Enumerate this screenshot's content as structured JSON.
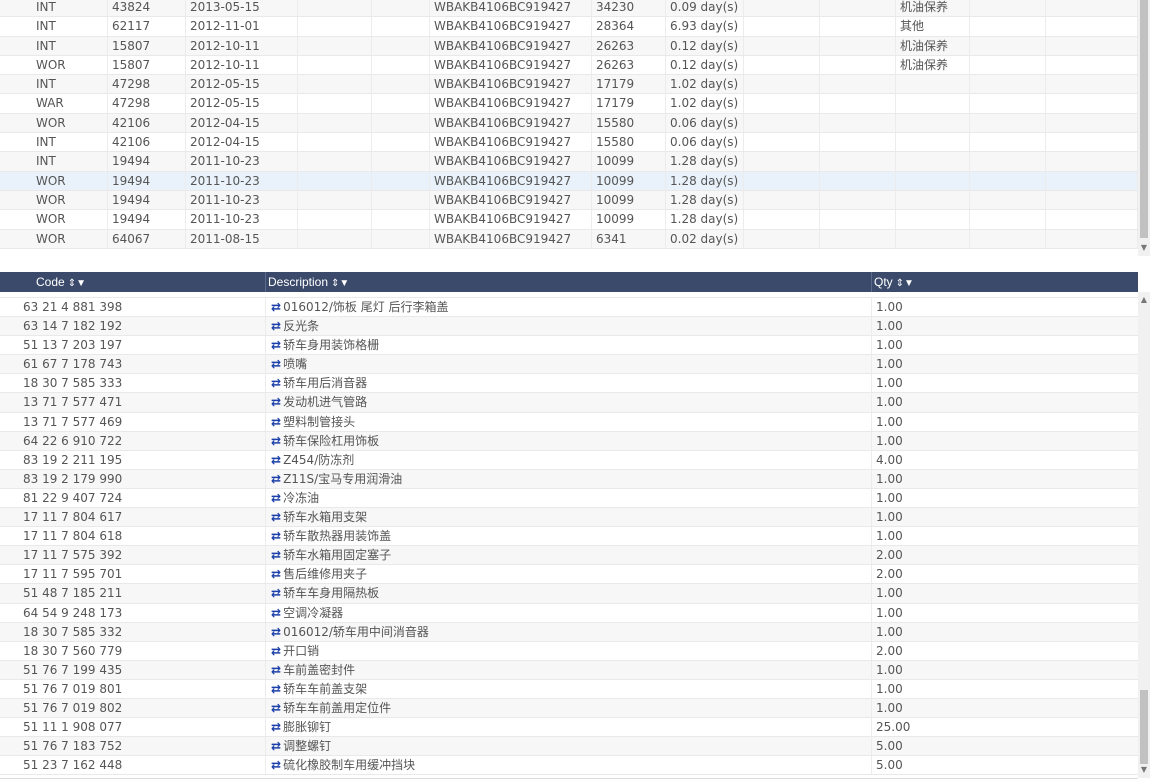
{
  "top_rows": [
    {
      "type": "INT",
      "id": "43824",
      "date": "2013-05-15",
      "vin": "WBAKB4106BC919427",
      "km": "34230",
      "dur": "0.09 day(s)",
      "note": "机油保养"
    },
    {
      "type": "INT",
      "id": "62117",
      "date": "2012-11-01",
      "vin": "WBAKB4106BC919427",
      "km": "28364",
      "dur": "6.93 day(s)",
      "note": "其他"
    },
    {
      "type": "INT",
      "id": "15807",
      "date": "2012-10-11",
      "vin": "WBAKB4106BC919427",
      "km": "26263",
      "dur": "0.12 day(s)",
      "note": "机油保养"
    },
    {
      "type": "WOR",
      "id": "15807",
      "date": "2012-10-11",
      "vin": "WBAKB4106BC919427",
      "km": "26263",
      "dur": "0.12 day(s)",
      "note": "机油保养"
    },
    {
      "type": "INT",
      "id": "47298",
      "date": "2012-05-15",
      "vin": "WBAKB4106BC919427",
      "km": "17179",
      "dur": "1.02 day(s)",
      "note": ""
    },
    {
      "type": "WAR",
      "id": "47298",
      "date": "2012-05-15",
      "vin": "WBAKB4106BC919427",
      "km": "17179",
      "dur": "1.02 day(s)",
      "note": ""
    },
    {
      "type": "WOR",
      "id": "42106",
      "date": "2012-04-15",
      "vin": "WBAKB4106BC919427",
      "km": "15580",
      "dur": "0.06 day(s)",
      "note": ""
    },
    {
      "type": "INT",
      "id": "42106",
      "date": "2012-04-15",
      "vin": "WBAKB4106BC919427",
      "km": "15580",
      "dur": "0.06 day(s)",
      "note": ""
    },
    {
      "type": "INT",
      "id": "19494",
      "date": "2011-10-23",
      "vin": "WBAKB4106BC919427",
      "km": "10099",
      "dur": "1.28 day(s)",
      "note": ""
    },
    {
      "type": "WOR",
      "id": "19494",
      "date": "2011-10-23",
      "vin": "WBAKB4106BC919427",
      "km": "10099",
      "dur": "1.28 day(s)",
      "note": ""
    },
    {
      "type": "WOR",
      "id": "19494",
      "date": "2011-10-23",
      "vin": "WBAKB4106BC919427",
      "km": "10099",
      "dur": "1.28 day(s)",
      "note": ""
    },
    {
      "type": "WOR",
      "id": "19494",
      "date": "2011-10-23",
      "vin": "WBAKB4106BC919427",
      "km": "10099",
      "dur": "1.28 day(s)",
      "note": ""
    },
    {
      "type": "WOR",
      "id": "64067",
      "date": "2011-08-15",
      "vin": "WBAKB4106BC919427",
      "km": "6341",
      "dur": "0.02 day(s)",
      "note": ""
    }
  ],
  "parts_header": {
    "code": "Code",
    "description": "Description",
    "qty": "Qty",
    "sort_filter": "⇕▼"
  },
  "parts": [
    {
      "code": "63 21 4 881 398",
      "desc": "016012/饰板 尾灯 后行李箱盖",
      "qty": "1.00"
    },
    {
      "code": "63 14 7 182 192",
      "desc": "反光条",
      "qty": "1.00"
    },
    {
      "code": "51 13 7 203 197",
      "desc": "轿车身用装饰格栅",
      "qty": "1.00"
    },
    {
      "code": "61 67 7 178 743",
      "desc": "喷嘴",
      "qty": "1.00"
    },
    {
      "code": "18 30 7 585 333",
      "desc": "轿车用后消音器",
      "qty": "1.00"
    },
    {
      "code": "13 71 7 577 471",
      "desc": "发动机进气管路",
      "qty": "1.00"
    },
    {
      "code": "13 71 7 577 469",
      "desc": "塑料制管接头",
      "qty": "1.00"
    },
    {
      "code": "64 22 6 910 722",
      "desc": "轿车保险杠用饰板",
      "qty": "1.00"
    },
    {
      "code": "83 19 2 211 195",
      "desc": "Z454/防冻剂",
      "qty": "4.00"
    },
    {
      "code": "83 19 2 179 990",
      "desc": "Z11S/宝马专用润滑油",
      "qty": "1.00"
    },
    {
      "code": "81 22 9 407 724",
      "desc": "冷冻油",
      "qty": "1.00"
    },
    {
      "code": "17 11 7 804 617",
      "desc": "轿车水箱用支架",
      "qty": "1.00"
    },
    {
      "code": "17 11 7 804 618",
      "desc": "轿车散热器用装饰盖",
      "qty": "1.00"
    },
    {
      "code": "17 11 7 575 392",
      "desc": "轿车水箱用固定塞子",
      "qty": "2.00"
    },
    {
      "code": "17 11 7 595 701",
      "desc": "售后维修用夹子",
      "qty": "2.00"
    },
    {
      "code": "51 48 7 185 211",
      "desc": "轿车车身用隔热板",
      "qty": "1.00"
    },
    {
      "code": "64 54 9 248 173",
      "desc": "空调冷凝器",
      "qty": "1.00"
    },
    {
      "code": "18 30 7 585 332",
      "desc": "016012/轿车用中间消音器",
      "qty": "1.00"
    },
    {
      "code": "18 30 7 560 779",
      "desc": "开口销",
      "qty": "2.00"
    },
    {
      "code": "51 76 7 199 435",
      "desc": "车前盖密封件",
      "qty": "1.00"
    },
    {
      "code": "51 76 7 019 801",
      "desc": "轿车车前盖支架",
      "qty": "1.00"
    },
    {
      "code": "51 76 7 019 802",
      "desc": "轿车车前盖用定位件",
      "qty": "1.00"
    },
    {
      "code": "51 11 1 908 077",
      "desc": "膨胀铆钉",
      "qty": "25.00"
    },
    {
      "code": "51 76 7 183 752",
      "desc": "调整螺钉",
      "qty": "5.00"
    },
    {
      "code": "51 23 7 162 448",
      "desc": "硫化橡胶制车用缓冲挡块",
      "qty": "5.00"
    }
  ],
  "icons": {
    "swap": "⇄"
  }
}
